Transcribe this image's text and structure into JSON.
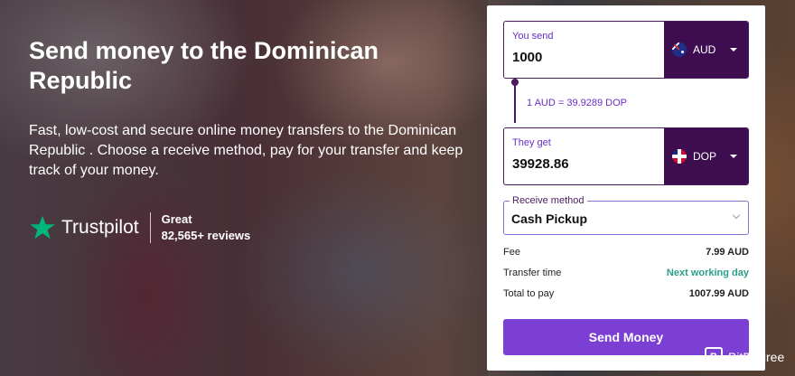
{
  "hero": {
    "title": "Send money to the Dominican Republic",
    "description": "Fast, low-cost and secure online money transfers to the Dominican Republic . Choose a receive method, pay for your transfer and keep track of your money."
  },
  "trustpilot": {
    "brand": "Trustpilot",
    "rating_label": "Great",
    "reviews": "82,565+ reviews",
    "star_color": "#00b67a"
  },
  "form": {
    "send": {
      "label": "You send",
      "amount": "1000",
      "currency": "AUD",
      "flag_icon": "australia-flag-icon"
    },
    "rate": "1 AUD = 39.9289 DOP",
    "receive": {
      "label": "They get",
      "amount": "39928.86",
      "currency": "DOP",
      "flag_icon": "dominican-republic-flag-icon"
    },
    "receive_method": {
      "legend": "Receive method",
      "value": "Cash Pickup"
    },
    "summary": [
      {
        "label": "Fee",
        "value": "7.99 AUD"
      },
      {
        "label": "Transfer time",
        "value": "Next working day"
      },
      {
        "label": "Total to pay",
        "value": "1007.99 AUD"
      }
    ],
    "submit_label": "Send Money"
  },
  "watermark": {
    "text": "BitDegree",
    "mark": "B"
  },
  "colors": {
    "accent": "#7b3fd4",
    "currency_bg": "#3d0d4f",
    "label_purple": "#6a2ec9",
    "success_green": "#2a9d8a"
  }
}
